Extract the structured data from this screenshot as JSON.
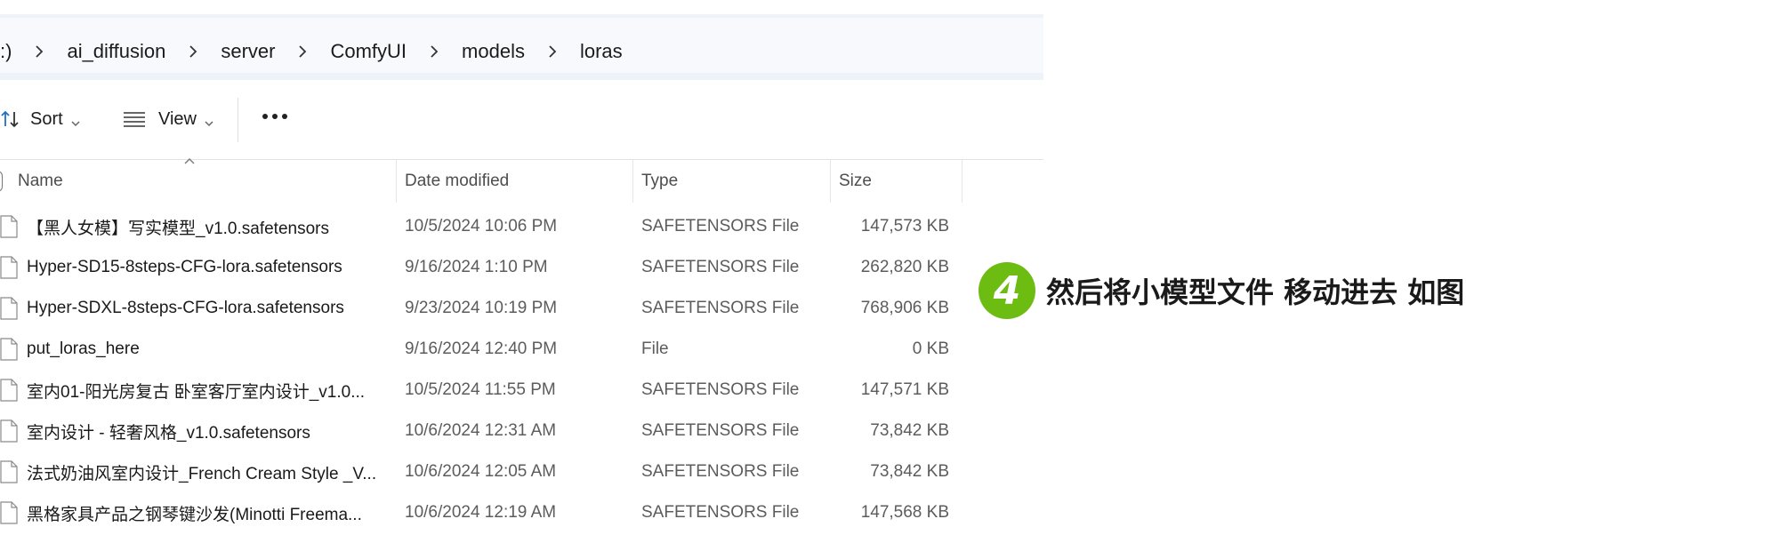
{
  "breadcrumb": {
    "items": [
      ":)",
      "ai_diffusion",
      "server",
      "ComfyUI",
      "models",
      "loras"
    ]
  },
  "toolbar": {
    "sort_label": "Sort",
    "view_label": "View",
    "more_icon": "more-options-icon"
  },
  "columns": {
    "name": "Name",
    "date_modified": "Date modified",
    "type": "Type",
    "size": "Size"
  },
  "files": [
    {
      "name": "【黑人女模】写实模型_v1.0.safetensors",
      "date": "10/5/2024 10:06 PM",
      "type": "SAFETENSORS File",
      "size": "147,573 KB"
    },
    {
      "name": "Hyper-SD15-8steps-CFG-lora.safetensors",
      "date": "9/16/2024 1:10 PM",
      "type": "SAFETENSORS File",
      "size": "262,820 KB"
    },
    {
      "name": "Hyper-SDXL-8steps-CFG-lora.safetensors",
      "date": "9/23/2024 10:19 PM",
      "type": "SAFETENSORS File",
      "size": "768,906 KB"
    },
    {
      "name": "put_loras_here",
      "date": "9/16/2024 12:40 PM",
      "type": "File",
      "size": "0 KB"
    },
    {
      "name": "室内01-阳光房复古 卧室客厅室内设计_v1.0...",
      "date": "10/5/2024 11:55 PM",
      "type": "SAFETENSORS File",
      "size": "147,571 KB"
    },
    {
      "name": "室内设计 - 轻奢风格_v1.0.safetensors",
      "date": "10/6/2024 12:31 AM",
      "type": "SAFETENSORS File",
      "size": "73,842 KB"
    },
    {
      "name": "法式奶油风室内设计_French Cream Style _V...",
      "date": "10/6/2024 12:05 AM",
      "type": "SAFETENSORS File",
      "size": "73,842 KB"
    },
    {
      "name": "黑格家具产品之钢琴键沙发(Minotti Freema...",
      "date": "10/6/2024 12:19 AM",
      "type": "SAFETENSORS File",
      "size": "147,568 KB"
    }
  ],
  "annotation": {
    "step_number": "4",
    "text": "然后将小模型文件 移动进去 如图",
    "badge_color": "#6cbc12"
  }
}
